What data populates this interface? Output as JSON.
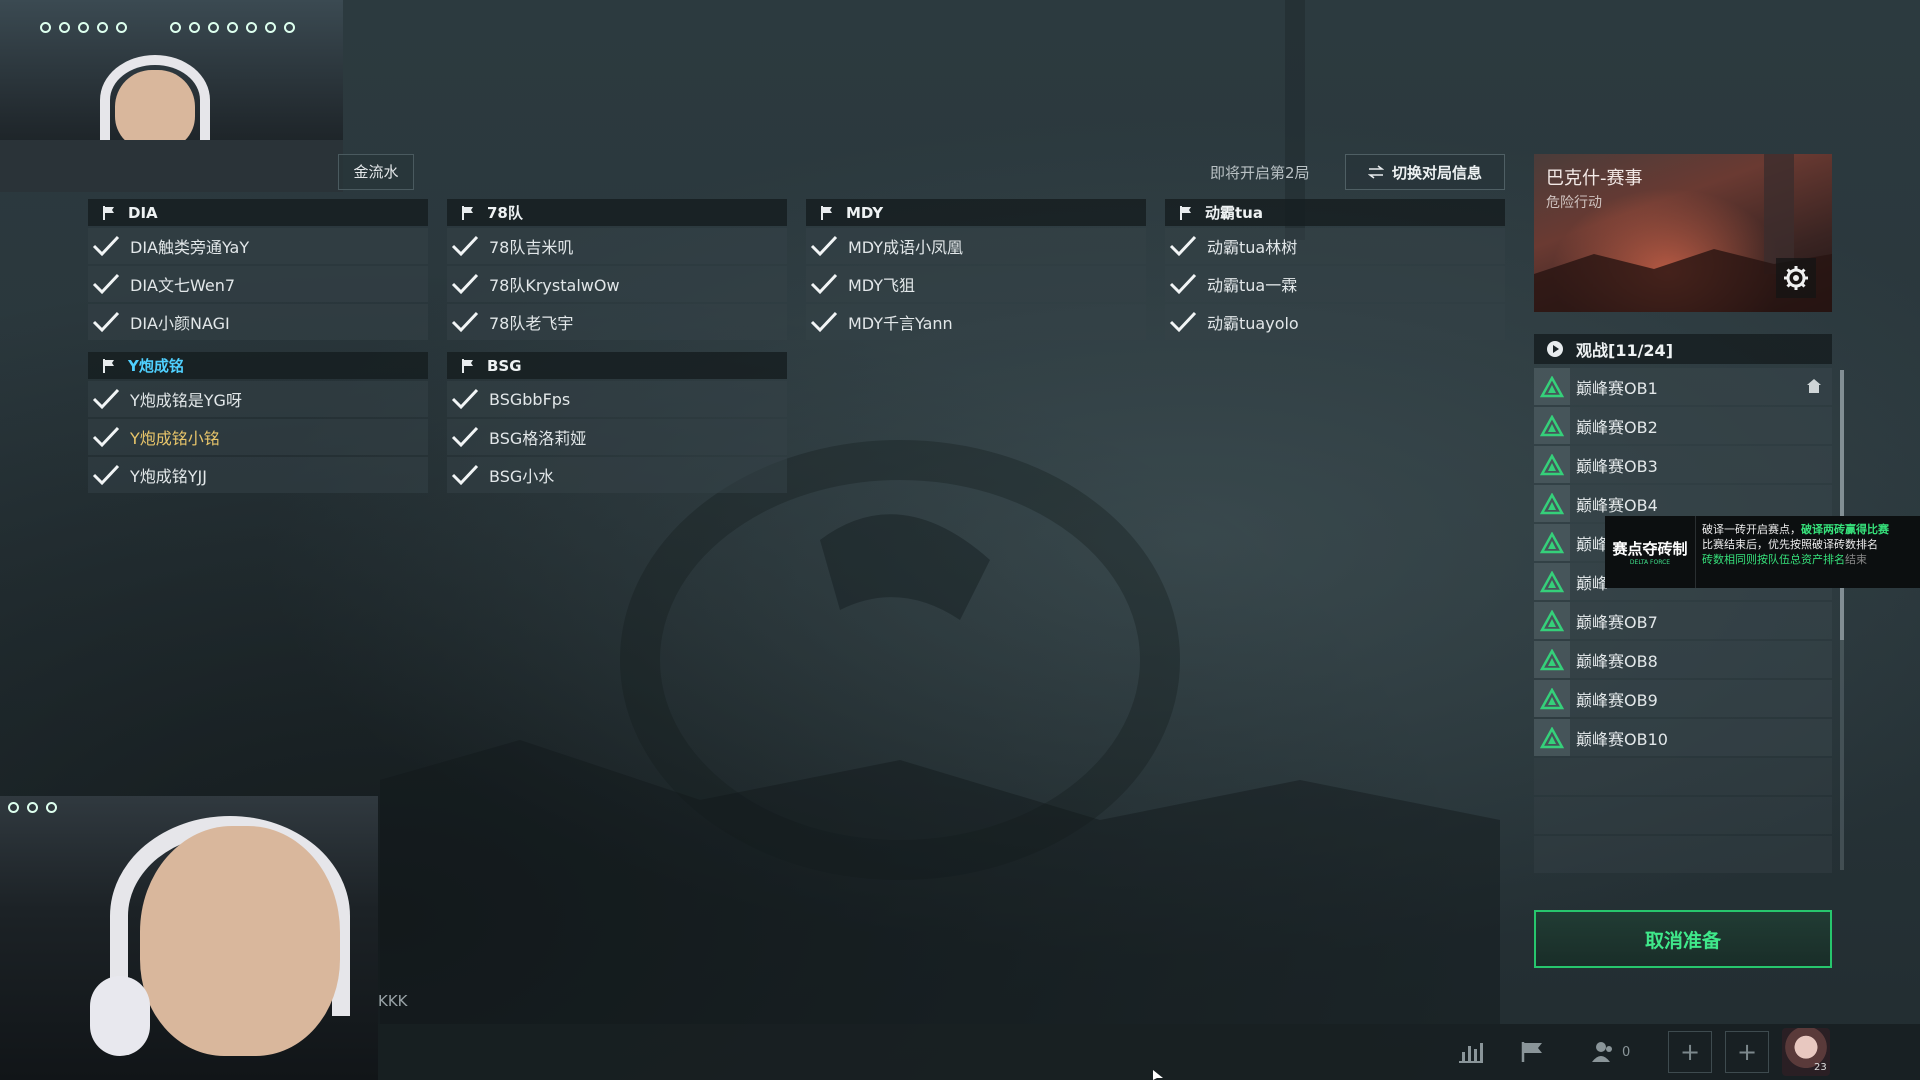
{
  "left_tab_label": "金流水",
  "teams": [
    {
      "name": "DIA",
      "highlight": false,
      "players": [
        {
          "name": "DIA触类旁通YaY",
          "gold": false
        },
        {
          "name": "DIA文七Wen7",
          "gold": false
        },
        {
          "name": "DIA小颜NAGI",
          "gold": false
        }
      ]
    },
    {
      "name": "78队",
      "highlight": false,
      "players": [
        {
          "name": "78队吉米叽",
          "gold": false
        },
        {
          "name": "78队KrystalwOw",
          "gold": false
        },
        {
          "name": "78队老飞宇",
          "gold": false
        }
      ]
    },
    {
      "name": "MDY",
      "highlight": false,
      "players": [
        {
          "name": "MDY成语小凤凰",
          "gold": false
        },
        {
          "name": "MDY飞狙",
          "gold": false
        },
        {
          "name": "MDY千言Yann",
          "gold": false
        }
      ]
    },
    {
      "name": "动霸tua",
      "highlight": false,
      "players": [
        {
          "name": "动霸tua林树",
          "gold": false
        },
        {
          "name": "动霸tua一霖",
          "gold": false
        },
        {
          "name": "动霸tuayolo",
          "gold": false
        }
      ]
    },
    {
      "name": "Y炮成铭",
      "highlight": true,
      "players": [
        {
          "name": "Y炮成铭是YG呀",
          "gold": false
        },
        {
          "name": "Y炮成铭小铭",
          "gold": true
        },
        {
          "name": "Y炮成铭YJJ",
          "gold": false
        }
      ]
    },
    {
      "name": "BSG",
      "highlight": false,
      "players": [
        {
          "name": "BSGbbFps",
          "gold": false
        },
        {
          "name": "BSG格洛莉娅",
          "gold": false
        },
        {
          "name": "BSG小水",
          "gold": false
        }
      ]
    }
  ],
  "upcoming_text": "即将开启第2局",
  "switch_button_label": "切换对局信息",
  "map": {
    "title": "巴克什-赛事",
    "subtitle": "危险行动"
  },
  "spectate": {
    "header": "观战[11/24]",
    "items": [
      "巅峰赛OB1",
      "巅峰赛OB2",
      "巅峰赛OB3",
      "巅峰赛OB4",
      "巅峰",
      "巅峰",
      "巅峰赛OB7",
      "巅峰赛OB8",
      "巅峰赛OB9",
      "巅峰赛OB10"
    ]
  },
  "ad": {
    "left_big": "赛点夺砖制",
    "left_small": "DELTA FORCE",
    "line1_a": "破译一砖开启赛点，",
    "line1_b": "破译两砖赢得比赛",
    "line2": "比赛结束后，优先按照破译砖数排名",
    "line3_a": "砖数相同则按队伍总资产排名",
    "line3_b": "结束"
  },
  "cancel_button_label": "取消准备",
  "kkk_text": "KKK",
  "friends_count": "0",
  "avatar_badge": "23",
  "colors": {
    "accent_green": "#27c66d",
    "highlight_blue": "#4fd0ff",
    "gold_name": "#e8c56a"
  },
  "icons": [
    "flag-icon",
    "check-icon",
    "swap-icon",
    "gear-icon",
    "play-icon",
    "triangle-icon",
    "home-icon",
    "stats-icon",
    "flag-icon",
    "friends-icon",
    "plus-icon"
  ]
}
